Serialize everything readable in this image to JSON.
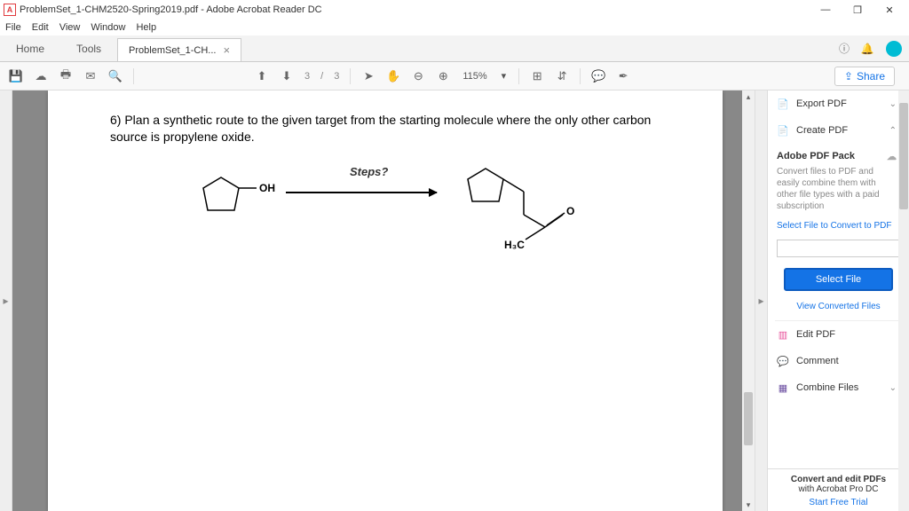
{
  "window": {
    "title": "ProblemSet_1-CHM2520-Spring2019.pdf - Adobe Acrobat Reader DC",
    "app_glyph": "A"
  },
  "menubar": [
    "File",
    "Edit",
    "View",
    "Window",
    "Help"
  ],
  "tabs": {
    "home": "Home",
    "tools": "Tools",
    "doc": "ProblemSet_1-CH...",
    "close": "×"
  },
  "toolbar": {
    "page_current": "3",
    "page_sep": "/",
    "page_total": "3",
    "zoom": "115%",
    "zoom_caret": "▾",
    "share": "Share"
  },
  "document": {
    "question": "6)  Plan a synthetic route to the given target from the starting molecule where the only other carbon source is propylene oxide.",
    "steps_label": "Steps?",
    "labels": {
      "oh": "OH",
      "h3c": "H₃C",
      "o": "O"
    }
  },
  "rpanel": {
    "export": "Export PDF",
    "create": "Create PDF",
    "pack_title": "Adobe PDF Pack",
    "pack_desc": "Convert files to PDF and easily combine them with other file types with a paid subscription",
    "select_link": "Select File to Convert to PDF",
    "select_btn": "Select File",
    "view_converted": "View Converted Files",
    "edit": "Edit PDF",
    "comment": "Comment",
    "combine": "Combine Files",
    "footer1": "Convert and edit PDFs",
    "footer2": "with Acrobat Pro DC",
    "trial": "Start Free Trial"
  }
}
